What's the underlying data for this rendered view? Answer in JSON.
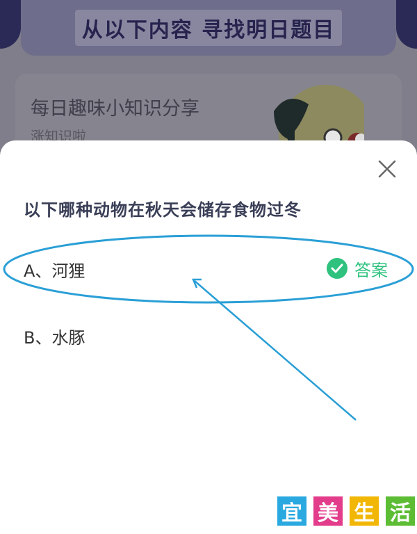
{
  "background": {
    "banner_title": "从以下内容 寻找明日题目",
    "card_title": "每日趣味小知识分享",
    "card_subtitle": "涨知识啦"
  },
  "quiz": {
    "question": "以下哪种动物在秋天会储存食物过冬",
    "options": [
      {
        "label": "A、河狸"
      },
      {
        "label": "B、水豚"
      }
    ],
    "answer_label": "答案",
    "answer_color": "#2ec27e"
  },
  "watermark": {
    "chars": [
      "宜",
      "美",
      "生",
      "活"
    ],
    "colors": [
      "#2aa9e0",
      "#e23c8b",
      "#f2b705",
      "#5cbd34"
    ]
  },
  "annotation_color": "#2a9fd6"
}
